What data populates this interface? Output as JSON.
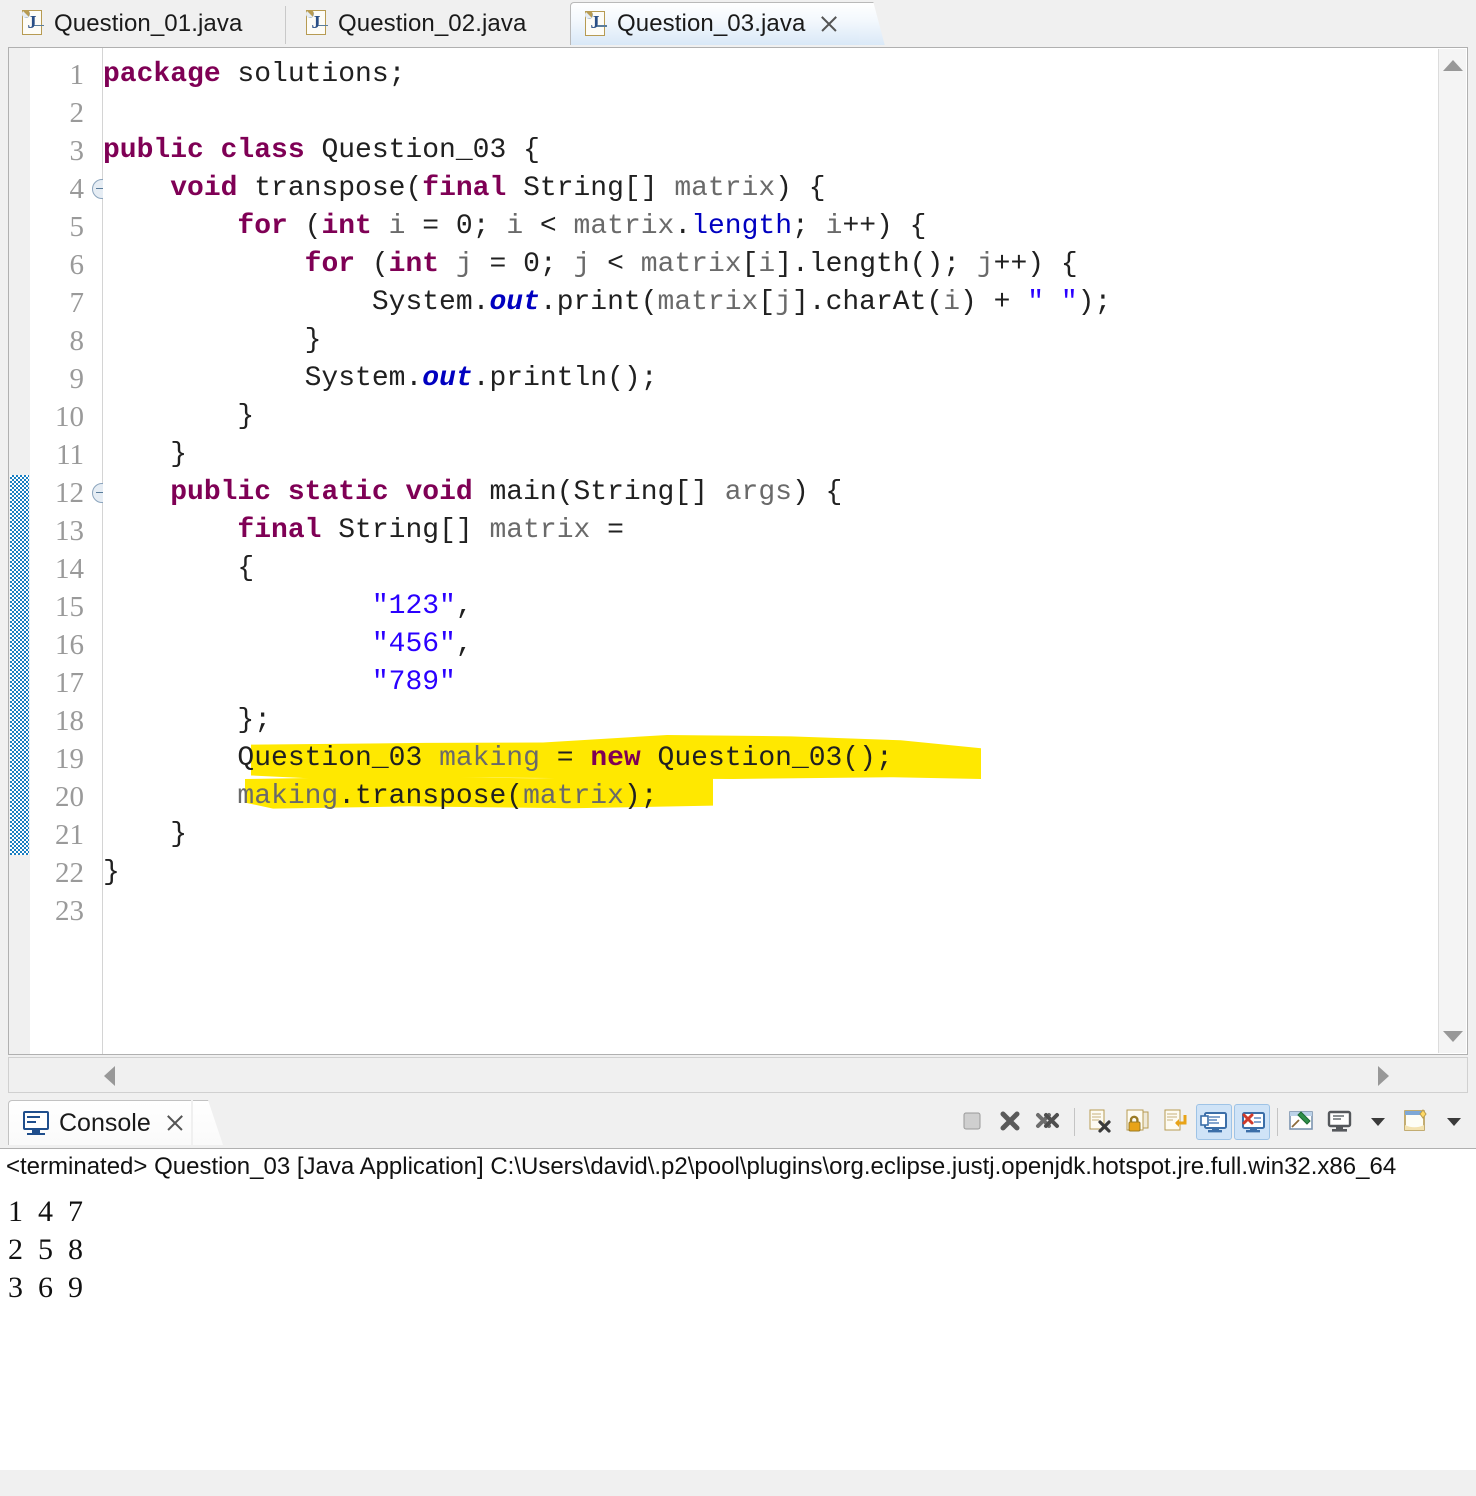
{
  "window": {
    "accent_tab_active": "#d9e8f7",
    "highlight_color": "#ffe800",
    "keyword_color": "#7f0055",
    "string_color": "#2a00ff"
  },
  "editor_tabs": [
    {
      "label": "Question_01.java",
      "icon": "java-file-icon",
      "letter": "J",
      "active": false,
      "closable": false
    },
    {
      "label": "Question_02.java",
      "icon": "java-file-icon",
      "letter": "J",
      "active": false,
      "closable": false
    },
    {
      "label": "Question_03.java",
      "icon": "java-file-icon",
      "letter": "J",
      "active": true,
      "closable": true
    }
  ],
  "editor": {
    "line_numbers": [
      "1",
      "2",
      "3",
      "4",
      "5",
      "6",
      "7",
      "8",
      "9",
      "10",
      "11",
      "12",
      "13",
      "14",
      "15",
      "16",
      "17",
      "18",
      "19",
      "20",
      "21",
      "22",
      "23"
    ],
    "fold_lines": [
      "4",
      "12"
    ],
    "current_line": "23",
    "change_bar_lines": "12-21",
    "code": [
      {
        "n": 1,
        "segs": [
          {
            "t": "package ",
            "c": "kw"
          },
          {
            "t": "solutions;",
            "c": ""
          }
        ]
      },
      {
        "n": 2,
        "segs": []
      },
      {
        "n": 3,
        "segs": [
          {
            "t": "public class ",
            "c": "kw"
          },
          {
            "t": "Question_03 {",
            "c": ""
          }
        ]
      },
      {
        "n": 4,
        "segs": [
          {
            "t": "    ",
            "c": ""
          },
          {
            "t": "void ",
            "c": "kw"
          },
          {
            "t": "transpose(",
            "c": ""
          },
          {
            "t": "final ",
            "c": "kw"
          },
          {
            "t": "String[] ",
            "c": ""
          },
          {
            "t": "matrix",
            "c": "lv"
          },
          {
            "t": ") {",
            "c": ""
          }
        ]
      },
      {
        "n": 5,
        "segs": [
          {
            "t": "        ",
            "c": ""
          },
          {
            "t": "for ",
            "c": "kw"
          },
          {
            "t": "(",
            "c": ""
          },
          {
            "t": "int ",
            "c": "kw"
          },
          {
            "t": "i",
            "c": "lv"
          },
          {
            "t": " = 0; ",
            "c": ""
          },
          {
            "t": "i",
            "c": "lv"
          },
          {
            "t": " < ",
            "c": ""
          },
          {
            "t": "matrix",
            "c": "lv"
          },
          {
            "t": ".",
            "c": ""
          },
          {
            "t": "length",
            "c": "fld"
          },
          {
            "t": "; ",
            "c": ""
          },
          {
            "t": "i",
            "c": "lv"
          },
          {
            "t": "++) {",
            "c": ""
          }
        ]
      },
      {
        "n": 6,
        "segs": [
          {
            "t": "            ",
            "c": ""
          },
          {
            "t": "for ",
            "c": "kw"
          },
          {
            "t": "(",
            "c": ""
          },
          {
            "t": "int ",
            "c": "kw"
          },
          {
            "t": "j",
            "c": "lv"
          },
          {
            "t": " = 0; ",
            "c": ""
          },
          {
            "t": "j",
            "c": "lv"
          },
          {
            "t": " < ",
            "c": ""
          },
          {
            "t": "matrix",
            "c": "lv"
          },
          {
            "t": "[",
            "c": ""
          },
          {
            "t": "i",
            "c": "lv"
          },
          {
            "t": "].length(); ",
            "c": ""
          },
          {
            "t": "j",
            "c": "lv"
          },
          {
            "t": "++) {",
            "c": ""
          }
        ]
      },
      {
        "n": 7,
        "segs": [
          {
            "t": "                System.",
            "c": ""
          },
          {
            "t": "out",
            "c": "sfld"
          },
          {
            "t": ".print(",
            "c": ""
          },
          {
            "t": "matrix",
            "c": "lv"
          },
          {
            "t": "[",
            "c": ""
          },
          {
            "t": "j",
            "c": "lv"
          },
          {
            "t": "].charAt(",
            "c": ""
          },
          {
            "t": "i",
            "c": "lv"
          },
          {
            "t": ") + ",
            "c": ""
          },
          {
            "t": "\" \"",
            "c": "str"
          },
          {
            "t": ");",
            "c": ""
          }
        ]
      },
      {
        "n": 8,
        "segs": [
          {
            "t": "            }",
            "c": ""
          }
        ]
      },
      {
        "n": 9,
        "segs": [
          {
            "t": "            System.",
            "c": ""
          },
          {
            "t": "out",
            "c": "sfld"
          },
          {
            "t": ".println();",
            "c": ""
          }
        ]
      },
      {
        "n": 10,
        "segs": [
          {
            "t": "        }",
            "c": ""
          }
        ]
      },
      {
        "n": 11,
        "segs": [
          {
            "t": "    }",
            "c": ""
          }
        ]
      },
      {
        "n": 12,
        "segs": [
          {
            "t": "    ",
            "c": ""
          },
          {
            "t": "public static void ",
            "c": "kw"
          },
          {
            "t": "main(String[] ",
            "c": ""
          },
          {
            "t": "args",
            "c": "lv"
          },
          {
            "t": ") {",
            "c": ""
          }
        ]
      },
      {
        "n": 13,
        "segs": [
          {
            "t": "        ",
            "c": ""
          },
          {
            "t": "final ",
            "c": "kw"
          },
          {
            "t": "String[] ",
            "c": ""
          },
          {
            "t": "matrix",
            "c": "lv"
          },
          {
            "t": " =",
            "c": ""
          }
        ]
      },
      {
        "n": 14,
        "segs": [
          {
            "t": "        {",
            "c": ""
          }
        ]
      },
      {
        "n": 15,
        "segs": [
          {
            "t": "                ",
            "c": ""
          },
          {
            "t": "\"123\"",
            "c": "str"
          },
          {
            "t": ",",
            "c": ""
          }
        ]
      },
      {
        "n": 16,
        "segs": [
          {
            "t": "                ",
            "c": ""
          },
          {
            "t": "\"456\"",
            "c": "str"
          },
          {
            "t": ",",
            "c": ""
          }
        ]
      },
      {
        "n": 17,
        "segs": [
          {
            "t": "                ",
            "c": ""
          },
          {
            "t": "\"789\"",
            "c": "str"
          }
        ]
      },
      {
        "n": 18,
        "segs": [
          {
            "t": "        };",
            "c": ""
          }
        ]
      },
      {
        "n": 19,
        "segs": [
          {
            "t": "        Question_03 ",
            "c": ""
          },
          {
            "t": "making",
            "c": "lv"
          },
          {
            "t": " = ",
            "c": ""
          },
          {
            "t": "new ",
            "c": "kw"
          },
          {
            "t": "Question_03();",
            "c": ""
          }
        ]
      },
      {
        "n": 20,
        "segs": [
          {
            "t": "        ",
            "c": ""
          },
          {
            "t": "making",
            "c": "lv"
          },
          {
            "t": ".transpose(",
            "c": ""
          },
          {
            "t": "matrix",
            "c": "lv"
          },
          {
            "t": ");",
            "c": ""
          }
        ]
      },
      {
        "n": 21,
        "segs": [
          {
            "t": "    }",
            "c": ""
          }
        ]
      },
      {
        "n": 22,
        "segs": [
          {
            "t": "}",
            "c": ""
          }
        ]
      },
      {
        "n": 23,
        "segs": []
      }
    ]
  },
  "console": {
    "tab_label": "Console",
    "tab_icon": "console-monitor-icon",
    "info_line": "<terminated> Question_03 [Java Application] C:\\Users\\david\\.p2\\pool\\plugins\\org.eclipse.justj.openjdk.hotspot.jre.full.win32.x86_64",
    "output": [
      "1  4  7",
      "2  5  8",
      "3  6  9"
    ],
    "toolbar": [
      {
        "name": "terminate-button",
        "icon": "stop-square-icon",
        "active": false,
        "disabled": true
      },
      {
        "name": "remove-launch-button",
        "icon": "x-icon",
        "active": false
      },
      {
        "name": "remove-all-terminated-button",
        "icon": "double-x-icon",
        "active": false
      },
      {
        "name": "clear-console-button",
        "icon": "clear-console-icon",
        "active": false
      },
      {
        "name": "scroll-lock-button",
        "icon": "lock-icon",
        "active": false
      },
      {
        "name": "word-wrap-button",
        "icon": "word-wrap-icon",
        "active": false
      },
      {
        "name": "show-console-on-output-button",
        "icon": "console-output-icon",
        "active": true
      },
      {
        "name": "show-console-on-error-button",
        "icon": "console-error-icon",
        "active": true
      },
      {
        "name": "pin-console-button",
        "icon": "pin-icon",
        "active": false
      },
      {
        "name": "display-selected-console-button",
        "icon": "monitor-icon",
        "active": false
      },
      {
        "name": "display-selected-console-dropdown",
        "icon": "chevron-down-icon",
        "active": false
      },
      {
        "name": "open-console-button",
        "icon": "new-console-icon",
        "active": false
      },
      {
        "name": "open-console-dropdown",
        "icon": "chevron-down-icon",
        "active": false
      }
    ]
  }
}
